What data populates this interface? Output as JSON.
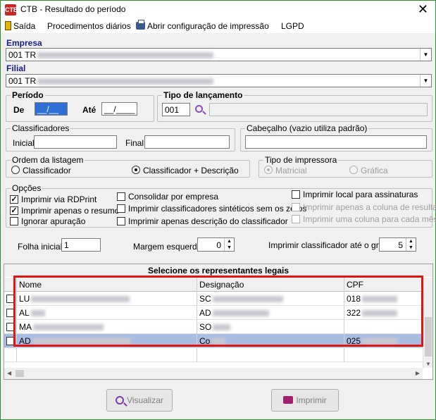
{
  "window": {
    "title": "CTB - Resultado do período",
    "app_icon": "CTB",
    "close_glyph": "✕"
  },
  "menu": {
    "items": [
      "Saída",
      "Procedimentos diários",
      "Abrir configuração de impressão",
      "LGPD"
    ]
  },
  "empresa": {
    "label": "Empresa",
    "value": "001 TR"
  },
  "filial": {
    "label": "Filial",
    "value": "001 TR"
  },
  "periodo": {
    "label": "Período",
    "de_label": "De",
    "de_value": "__/__",
    "ate_label": "Até",
    "ate_value": "__/____"
  },
  "tipo_lancamento": {
    "label": "Tipo de lançamento",
    "code": "001",
    "description": ""
  },
  "classificadores": {
    "label": "Classificadores",
    "inicial_label": "Inicial",
    "inicial_value": "",
    "final_label": "Final",
    "final_value": ""
  },
  "cabecalho": {
    "label": "Cabeçalho (vazio utiliza padrão)",
    "value": ""
  },
  "ordem": {
    "label": "Ordem da listagem",
    "options": [
      "Classificador",
      "Classificador + Descrição"
    ],
    "selected": 1
  },
  "tipo_impressora": {
    "label": "Tipo de impressora",
    "options": [
      "Matricial",
      "Gráfica"
    ],
    "selected": 0
  },
  "opcoes": {
    "label": "Opções",
    "col1": [
      {
        "label": "Imprimir via RDPrint",
        "checked": true
      },
      {
        "label": "Imprimir apenas o resumo",
        "checked": true
      },
      {
        "label": "Ignorar apuração",
        "checked": false
      }
    ],
    "col2": [
      {
        "label": "Consolidar por empresa",
        "checked": false
      },
      {
        "label": "Imprimir classificadores sintéticos sem os zeros",
        "checked": false
      },
      {
        "label": "Imprimir apenas descrição do classificador",
        "checked": false
      }
    ],
    "col3": [
      {
        "label": "Imprimir local para assinaturas",
        "checked": false,
        "disabled": false
      },
      {
        "label": "Imprimir apenas a coluna de resultado",
        "checked": false,
        "disabled": true
      },
      {
        "label": "Imprimir uma coluna para cada mês",
        "checked": false,
        "disabled": true
      }
    ]
  },
  "folha": {
    "label": "Folha inicial",
    "value": "1"
  },
  "margem": {
    "label": "Margem esquerda",
    "value": "0"
  },
  "grau": {
    "label": "Imprimir classificador até o grau",
    "value": "5"
  },
  "representantes": {
    "caption": "Selecione os representantes legais",
    "columns": [
      "Nome",
      "Designação",
      "CPF"
    ],
    "rows": [
      {
        "nome": "LU",
        "designacao": "SC",
        "cpf": "018"
      },
      {
        "nome": "AL",
        "designacao": "AD",
        "cpf": "322"
      },
      {
        "nome": "MA",
        "designacao": "SO",
        "cpf": ""
      },
      {
        "nome": "AD",
        "designacao": "Co",
        "cpf": "025"
      }
    ],
    "selected_row": 3
  },
  "buttons": {
    "visualizar": "Visualizar",
    "imprimir": "Imprimir"
  },
  "colors": {
    "highlight_box": "#e01515",
    "selected_row": "#a9bde3",
    "label_blue": "#1a1a8c"
  }
}
